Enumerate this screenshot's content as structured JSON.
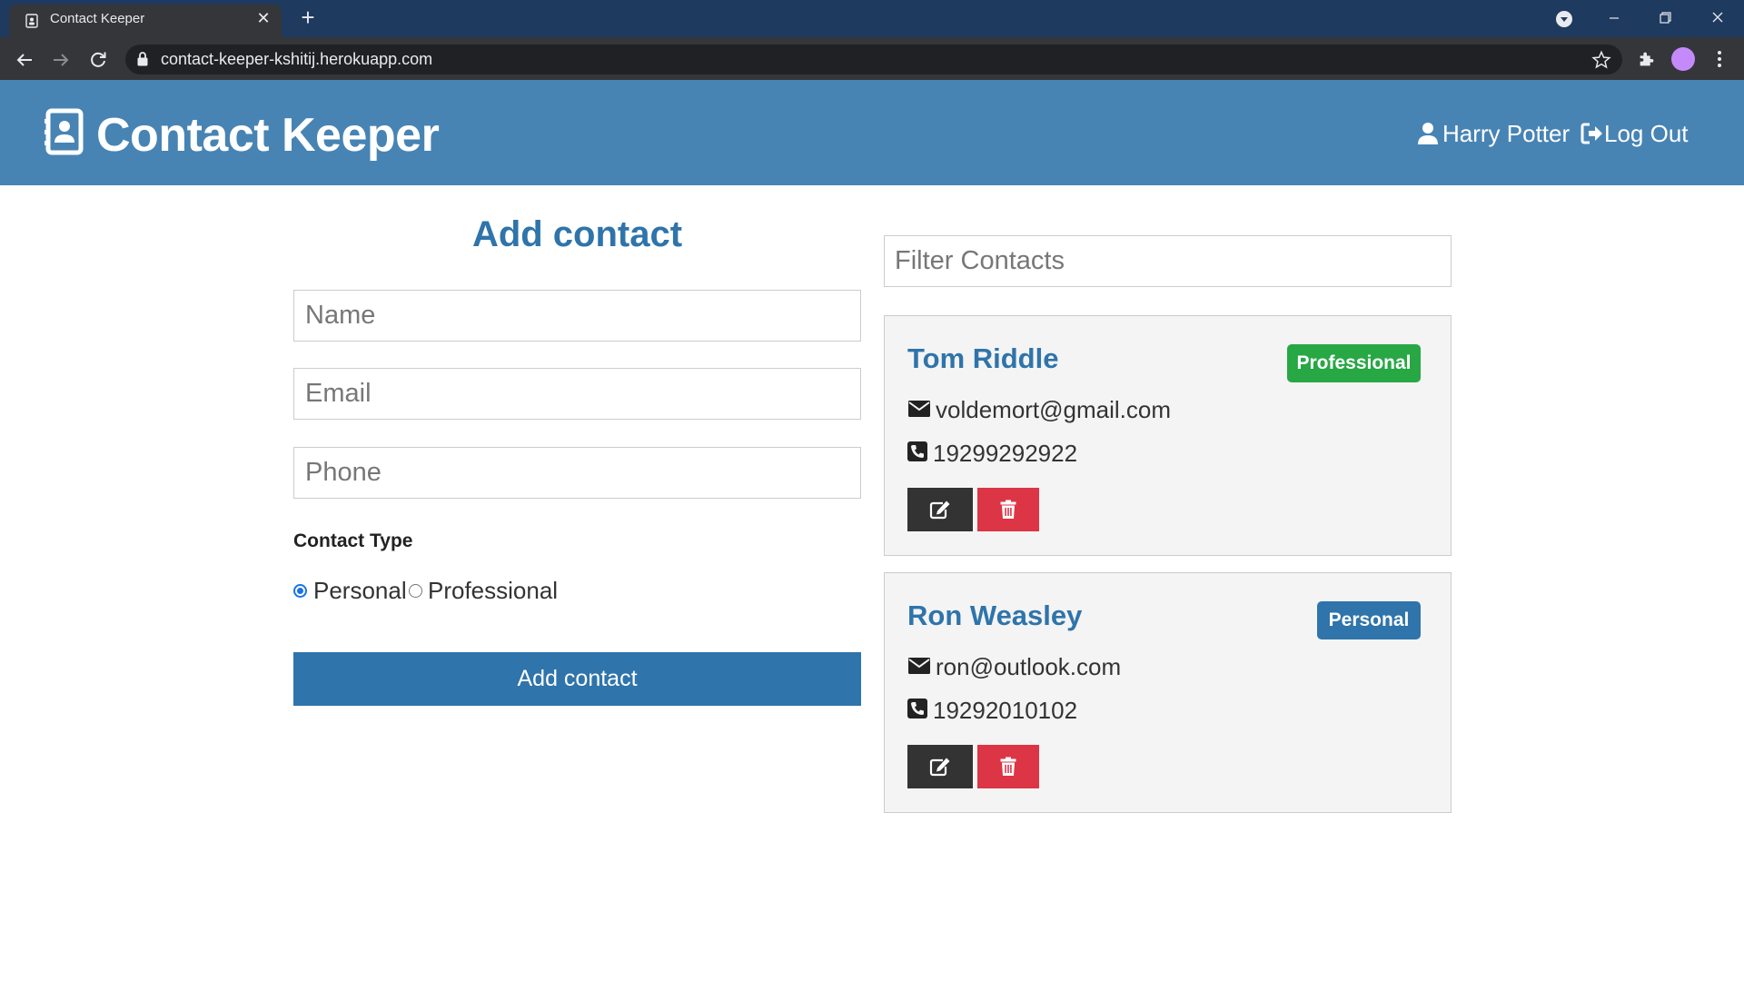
{
  "browser": {
    "tab_title": "Contact Keeper",
    "url": "contact-keeper-kshitij.herokuapp.com"
  },
  "navbar": {
    "brand": "Contact Keeper",
    "user": "Harry Potter",
    "logout": "Log Out",
    "color": "#4784b4"
  },
  "form": {
    "title": "Add contact",
    "name_placeholder": "Name",
    "email_placeholder": "Email",
    "phone_placeholder": "Phone",
    "contact_type_label": "Contact Type",
    "type_options": [
      "Personal",
      "Professional"
    ],
    "selected_type": "Personal",
    "submit_label": "Add contact"
  },
  "filter": {
    "placeholder": "Filter Contacts"
  },
  "contacts": [
    {
      "name": "Tom Riddle",
      "email": "voldemort@gmail.com",
      "phone": "19299292922",
      "type": "Professional",
      "badge_color": "#28a745"
    },
    {
      "name": "Ron Weasley",
      "email": "ron@outlook.com",
      "phone": "19292010102",
      "type": "Personal",
      "badge_color": "#2f74aa"
    }
  ],
  "icons": {
    "brand": "address-card-icon",
    "user": "user-icon",
    "logout": "sign-out-icon",
    "email": "envelope-icon",
    "phone": "phone-icon",
    "edit": "edit-icon",
    "delete": "trash-icon"
  },
  "colors": {
    "primary": "#2f74aa",
    "success": "#28a745",
    "danger": "#dc3545",
    "dark": "#333333"
  }
}
